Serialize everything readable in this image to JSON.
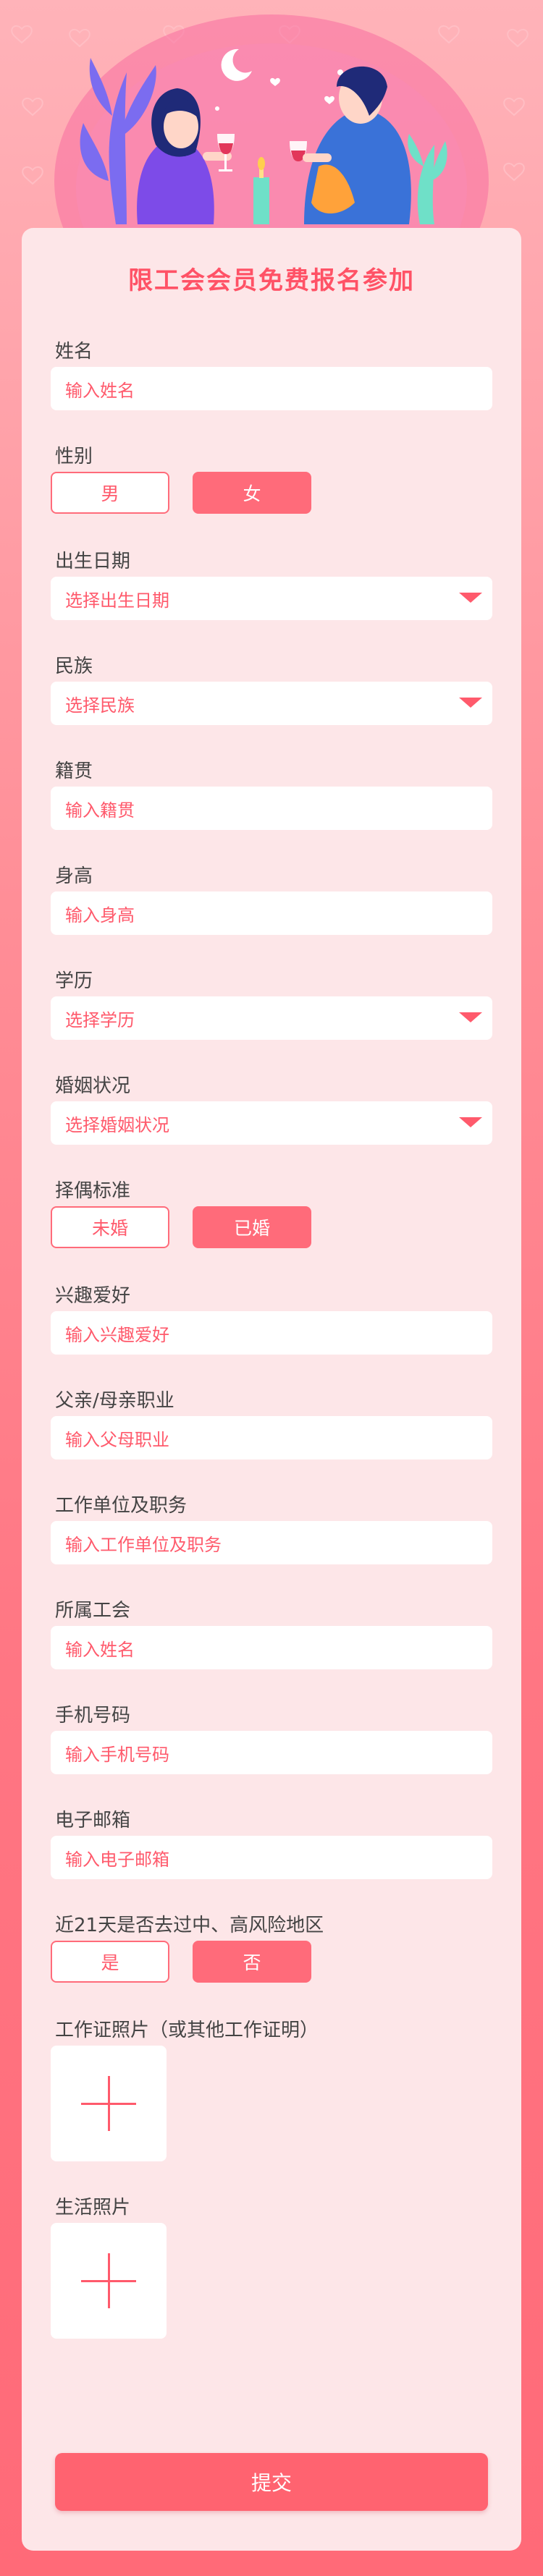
{
  "form": {
    "title": "限工会会员免费报名参加",
    "fields": [
      {
        "label": "姓名",
        "placeholder": "输入姓名"
      },
      {
        "label": "性别",
        "options": [
          "男",
          "女"
        ],
        "selected": "女"
      },
      {
        "label": "出生日期",
        "placeholder": "选择出生日期"
      },
      {
        "label": "民族",
        "placeholder": "选择民族"
      },
      {
        "label": "籍贯",
        "placeholder": "输入籍贯"
      },
      {
        "label": "身高",
        "placeholder": "输入身高"
      },
      {
        "label": "学历",
        "placeholder": "选择学历"
      },
      {
        "label": "婚姻状况",
        "placeholder": "选择婚姻状况"
      },
      {
        "label": "择偶标准",
        "options": [
          "未婚",
          "已婚"
        ],
        "selected": "已婚"
      },
      {
        "label": "兴趣爱好",
        "placeholder": "输入兴趣爱好"
      },
      {
        "label": "父亲/母亲职业",
        "placeholder": "输入父母职业"
      },
      {
        "label": "工作单位及职务",
        "placeholder": "输入工作单位及职务"
      },
      {
        "label": "所属工会",
        "placeholder": "输入姓名"
      },
      {
        "label": "手机号码",
        "placeholder": "输入手机号码"
      },
      {
        "label": "电子邮箱",
        "placeholder": "输入电子邮箱"
      },
      {
        "label": "近21天是否去过中、高风险地区",
        "options": [
          "是",
          "否"
        ],
        "selected": "否"
      },
      {
        "label": "工作证照片（或其他工作证明）"
      },
      {
        "label": "生活照片"
      }
    ],
    "submit_label": "提交"
  },
  "colors": {
    "accent": "#ff6b7a",
    "accent_text": "#ff5a6c",
    "card_bg": "#fde6e8",
    "page_top": "#ffb3b9",
    "page_bottom": "#ff6a78"
  },
  "icons": [
    "chevron-down-icon",
    "plus-icon",
    "heart-icon",
    "moon-icon"
  ]
}
